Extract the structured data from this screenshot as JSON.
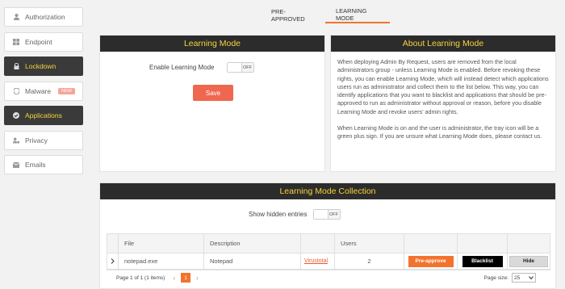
{
  "sidebar": {
    "items": [
      {
        "label": "Authorization",
        "icon": "user-icon",
        "active": false
      },
      {
        "label": "Endpoint",
        "icon": "windows-icon",
        "active": false
      },
      {
        "label": "Lockdown",
        "icon": "lock-icon",
        "active": true
      },
      {
        "label": "Malware",
        "icon": "shield-icon",
        "active": false,
        "badge": "NEW"
      },
      {
        "label": "Applications",
        "icon": "check-circle-icon",
        "active": true
      },
      {
        "label": "Privacy",
        "icon": "user-lock-icon",
        "active": false
      },
      {
        "label": "Emails",
        "icon": "envelope-icon",
        "active": false
      }
    ]
  },
  "tabs": [
    {
      "label": "PRE-APPROVED",
      "active": false
    },
    {
      "label": "LEARNING MODE",
      "active": true
    }
  ],
  "learning": {
    "title": "Learning Mode",
    "enable_label": "Enable Learning Mode",
    "toggle_state": "OFF",
    "save_label": "Save"
  },
  "about": {
    "title": "About Learning Mode",
    "para1": "When deploying Admin By Request, users are removed from the local administrators group - unless Learning Mode is enabled. Before revoking these rights, you can enable Learning Mode, which will instead detect which applications users run as administrator and collect them to the list below. This way, you can identify applications that you want to blacklist and applications that should be pre-approved to run as administrator without approval or reason, before you disable Learning Mode and revoke users' admin rights.",
    "para2": "When Learning Mode is on and the user is administrator, the tray icon will be a green plus sign. If you are unsure what Learning Mode does, please contact us."
  },
  "collection": {
    "title": "Learning Mode Collection",
    "show_hidden_label": "Show hidden entries",
    "toggle_state": "OFF",
    "columns": [
      "",
      "File",
      "Description",
      "",
      "Users",
      "",
      "",
      ""
    ],
    "rows": [
      {
        "file": "notepad.exe",
        "description": "Notepad",
        "link": "Virustotal",
        "users": "2",
        "pre_approve": "Pre-approve",
        "blacklist": "Blacklist",
        "hide": "Hide"
      }
    ],
    "pager": {
      "summary": "Page 1 of 1 (1 items)",
      "current_page": "1",
      "page_size_label": "Page size:",
      "page_size": "25"
    }
  },
  "colors": {
    "accent": "#f3732e",
    "header_bg": "#2c2c2c",
    "header_text": "#f7d33a",
    "save": "#f0674f"
  }
}
